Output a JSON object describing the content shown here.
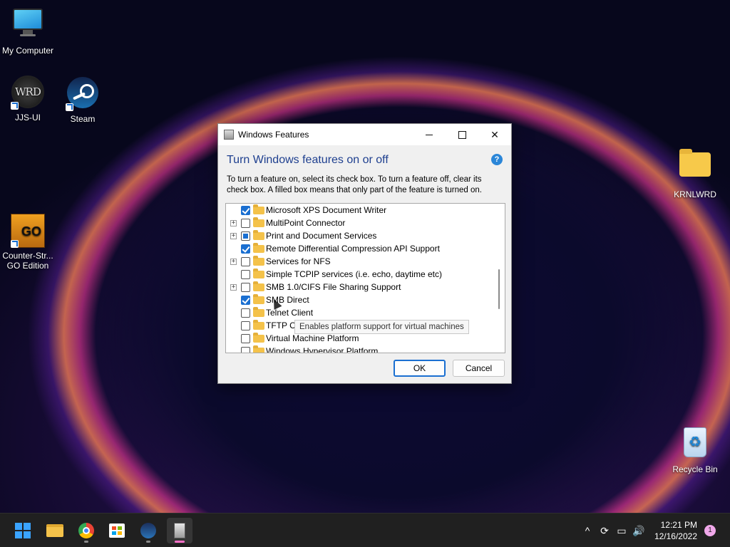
{
  "desktop": {
    "icons": {
      "my_computer": "My Computer",
      "jjs_ui": "JJS-UI",
      "jjs_glyph": "WRD",
      "steam": "Steam",
      "csgo_line1": "Counter-Str...",
      "csgo_line2": "GO Edition",
      "csgo_glyph": "GO",
      "krnlwrd": "KRNLWRD",
      "recycle_bin": "Recycle Bin"
    }
  },
  "dialog": {
    "title": "Windows Features",
    "heading": "Turn Windows features on or off",
    "help": "?",
    "description": "To turn a feature on, select its check box. To turn a feature off, clear its check box. A filled box means that only part of the feature is turned on.",
    "features": [
      {
        "label": "Microsoft XPS Document Writer",
        "state": "checked",
        "expandable": false
      },
      {
        "label": "MultiPoint Connector",
        "state": "unchecked",
        "expandable": true
      },
      {
        "label": "Print and Document Services",
        "state": "partial",
        "expandable": true
      },
      {
        "label": "Remote Differential Compression API Support",
        "state": "checked",
        "expandable": false
      },
      {
        "label": "Services for NFS",
        "state": "unchecked",
        "expandable": true
      },
      {
        "label": "Simple TCPIP services (i.e. echo, daytime etc)",
        "state": "unchecked",
        "expandable": false
      },
      {
        "label": "SMB 1.0/CIFS File Sharing Support",
        "state": "unchecked",
        "expandable": true
      },
      {
        "label": "SMB Direct",
        "state": "checked",
        "expandable": false
      },
      {
        "label": "Telnet Client",
        "state": "unchecked",
        "expandable": false
      },
      {
        "label": "TFTP Client",
        "state": "unchecked",
        "expandable": false
      },
      {
        "label": "Virtual Machine Platform",
        "state": "unchecked",
        "expandable": false
      },
      {
        "label": "Windows Hypervisor Platform",
        "state": "unchecked",
        "expandable": false
      }
    ],
    "tooltip": "Enables platform support for virtual machines",
    "ok_label": "OK",
    "cancel_label": "Cancel"
  },
  "taskbar": {
    "apps": [
      "start-icon",
      "file-explorer-icon",
      "chrome-icon",
      "microsoft-store-icon",
      "steam-icon",
      "windows-features-icon"
    ],
    "tray": {
      "chevron": "^",
      "time": "12:21 PM",
      "date": "12/16/2022",
      "notifications": "1"
    }
  },
  "colors": {
    "accent": "#1a6fd1",
    "heading": "#1e3f8f",
    "taskbar": "#202020"
  }
}
